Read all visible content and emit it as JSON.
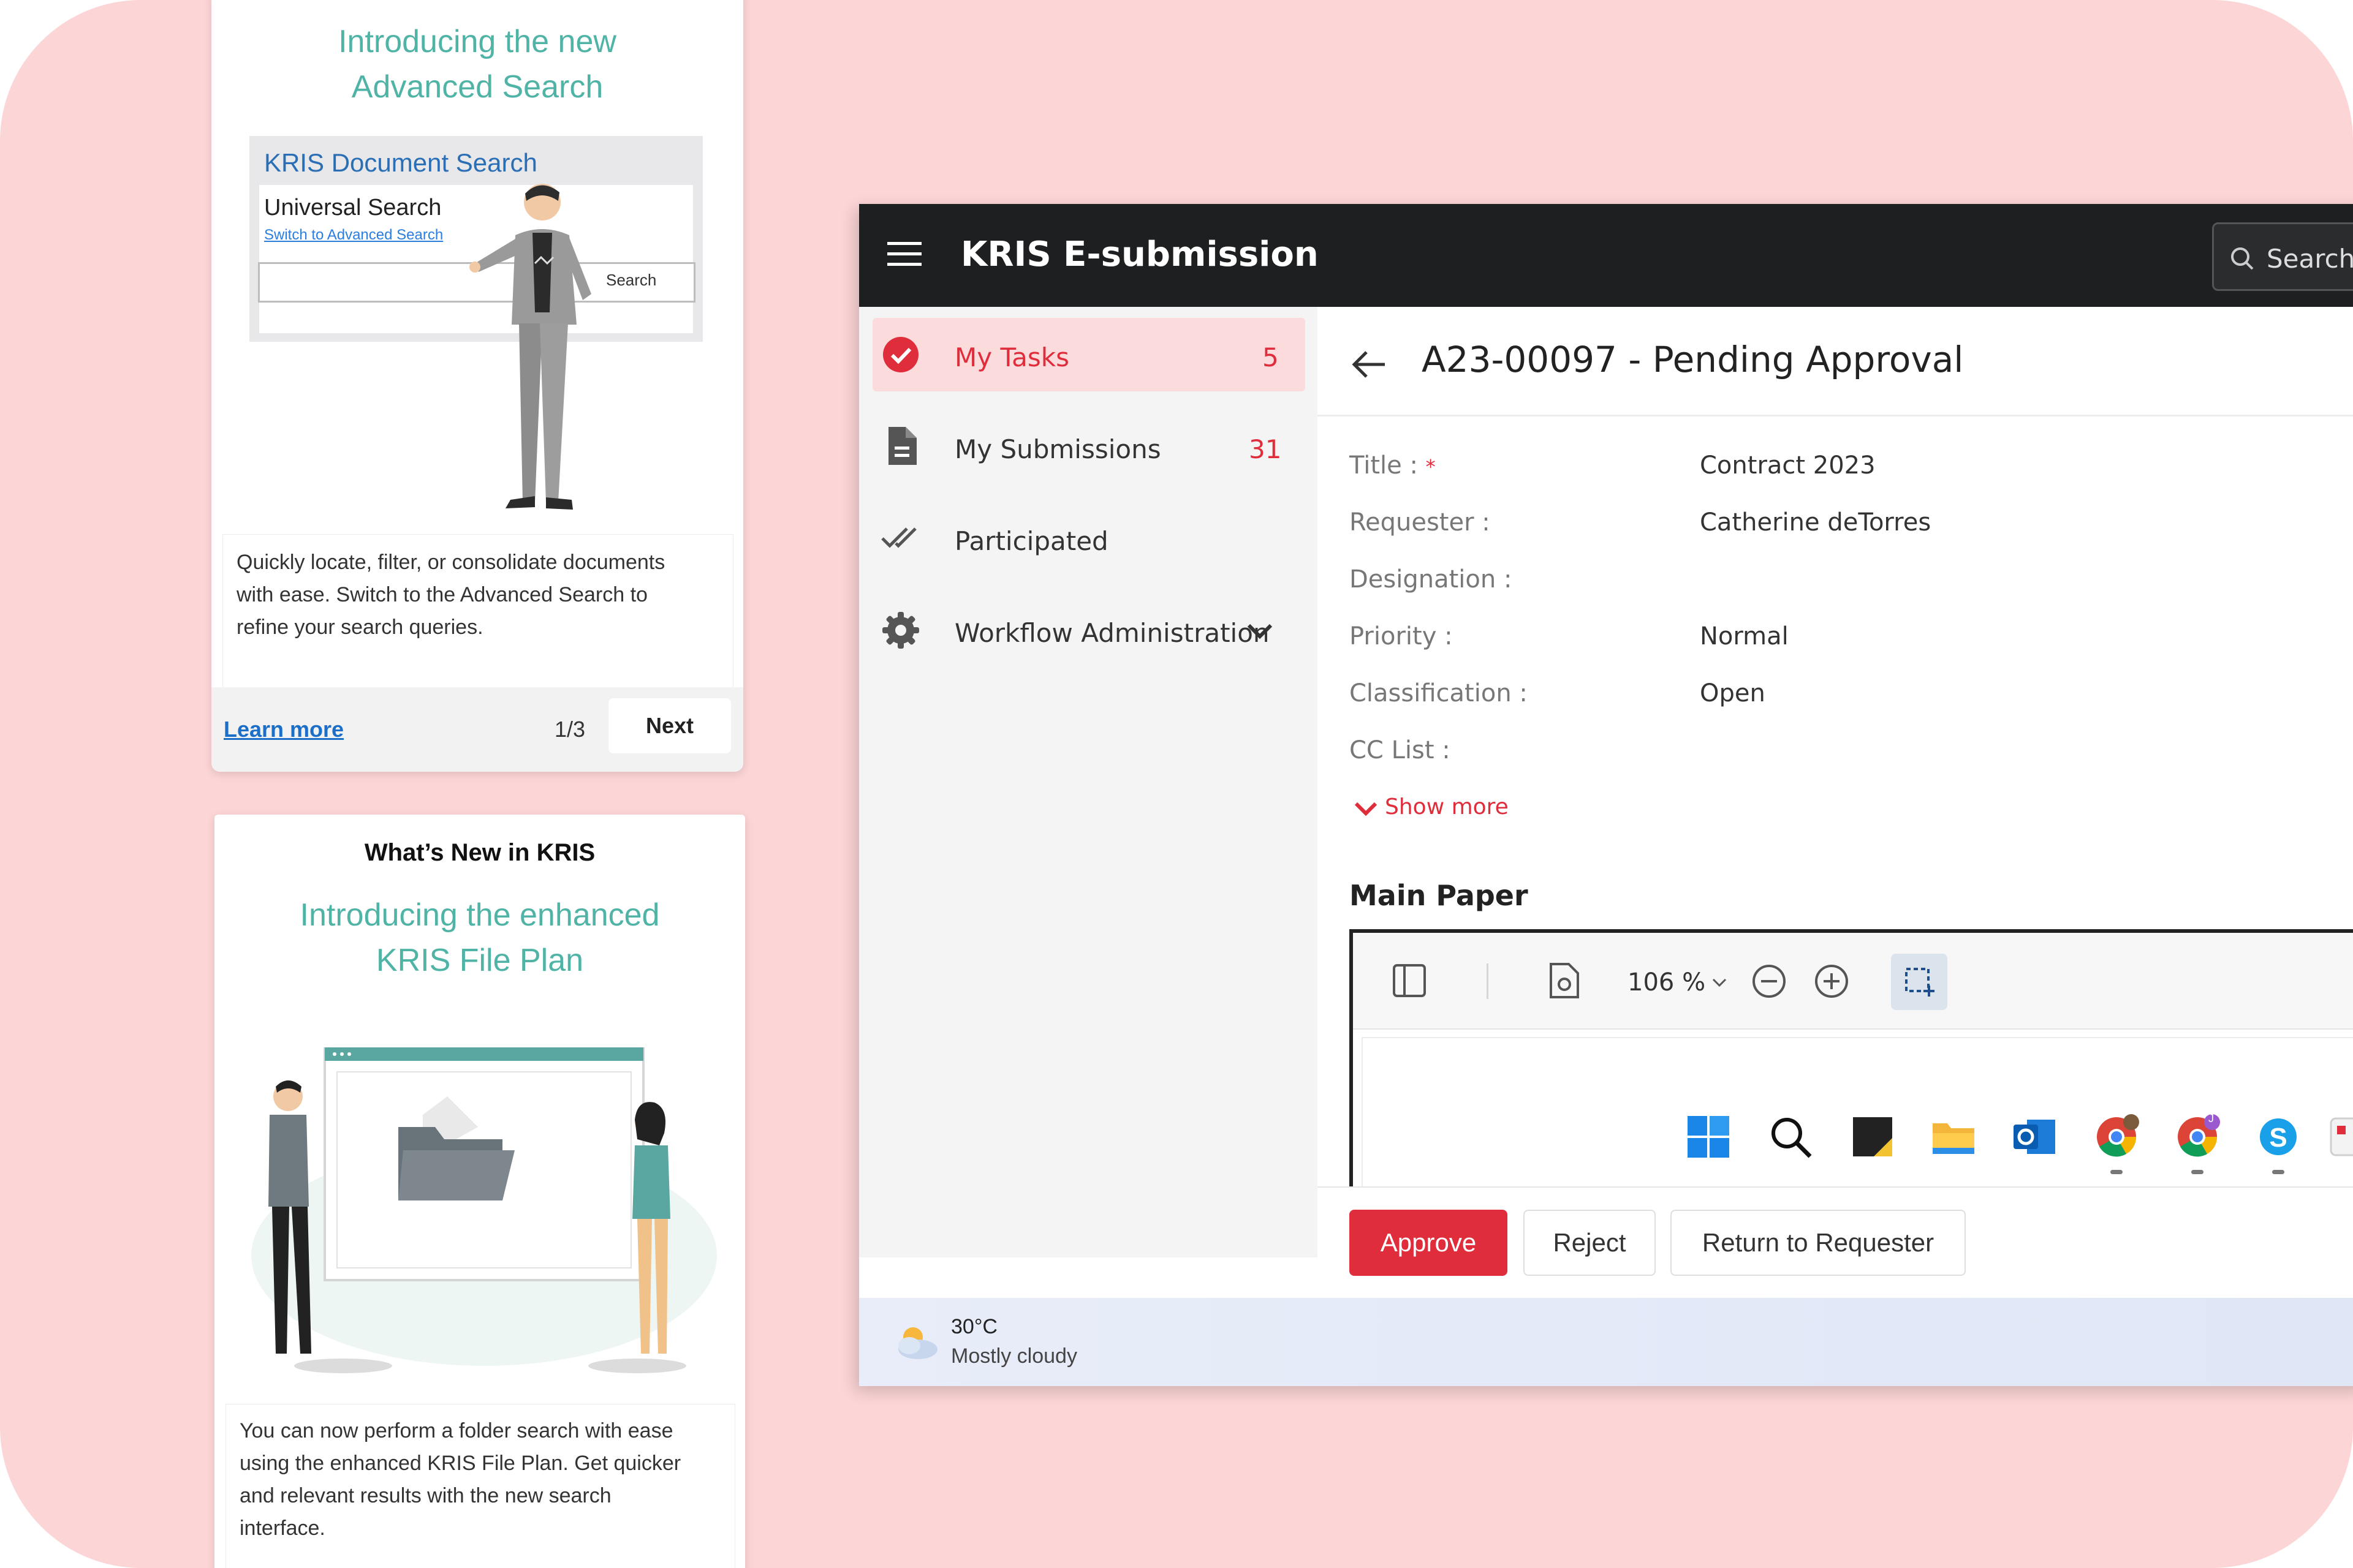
{
  "card1": {
    "headline_line1": "Introducing the new",
    "headline_line2": "Advanced Search",
    "illustration": {
      "title": "KRIS Document Search",
      "subtitle": "Universal Search",
      "link": "Switch to Advanced Search",
      "button": "Search"
    },
    "body": [
      "Quickly locate, filter, or consolidate documents",
      "with ease. Switch to the Advanced Search to",
      "refine your search queries."
    ],
    "learn_more": "Learn more",
    "pager": "1/3",
    "next": "Next"
  },
  "card2": {
    "heading": "What’s New in KRIS",
    "headline_line1": "Introducing the enhanced",
    "headline_line2": "KRIS File Plan",
    "body": [
      "You can now perform a folder search with ease",
      "using the enhanced KRIS File Plan. Get quicker",
      "and relevant results with the new search",
      "interface."
    ]
  },
  "app": {
    "title": "KRIS E-submission",
    "search_label": "Search",
    "sidebar": [
      {
        "label": "My Tasks",
        "count": "5",
        "icon": "check-circle-icon",
        "active": true
      },
      {
        "label": "My Submissions",
        "count": "31",
        "icon": "document-icon",
        "active": false
      },
      {
        "label": "Participated",
        "count": "",
        "icon": "double-check-icon",
        "active": false
      },
      {
        "label": "Workflow Administration",
        "count": "",
        "icon": "gear-icon",
        "active": false
      }
    ],
    "page_title": "A23-00097 - Pending Approval",
    "fields": [
      {
        "label": "Title :",
        "required": "*",
        "value": "Contract 2023"
      },
      {
        "label": "Requester :",
        "required": "",
        "value": "Catherine deTorres"
      },
      {
        "label": "Designation :",
        "required": "",
        "value": ""
      },
      {
        "label": "Priority :",
        "required": "",
        "value": "Normal"
      },
      {
        "label": "Classification :",
        "required": "",
        "value": "Open"
      },
      {
        "label": "CC List :",
        "required": "",
        "value": ""
      }
    ],
    "show_more": "Show more",
    "main_paper": "Main Paper",
    "viewer": {
      "zoom": "106 %"
    },
    "actions": {
      "approve": "Approve",
      "reject": "Reject",
      "return": "Return to Requester"
    }
  },
  "taskbar": {
    "temperature": "30°C",
    "weather": "Mostly cloudy",
    "chrome_badge": "J"
  },
  "colors": {
    "background": "#fcd5d6",
    "accent_red": "#e02d3c",
    "teal": "#4fb3a6",
    "topbar": "#1e1f20",
    "link_blue": "#1c6fc9"
  }
}
